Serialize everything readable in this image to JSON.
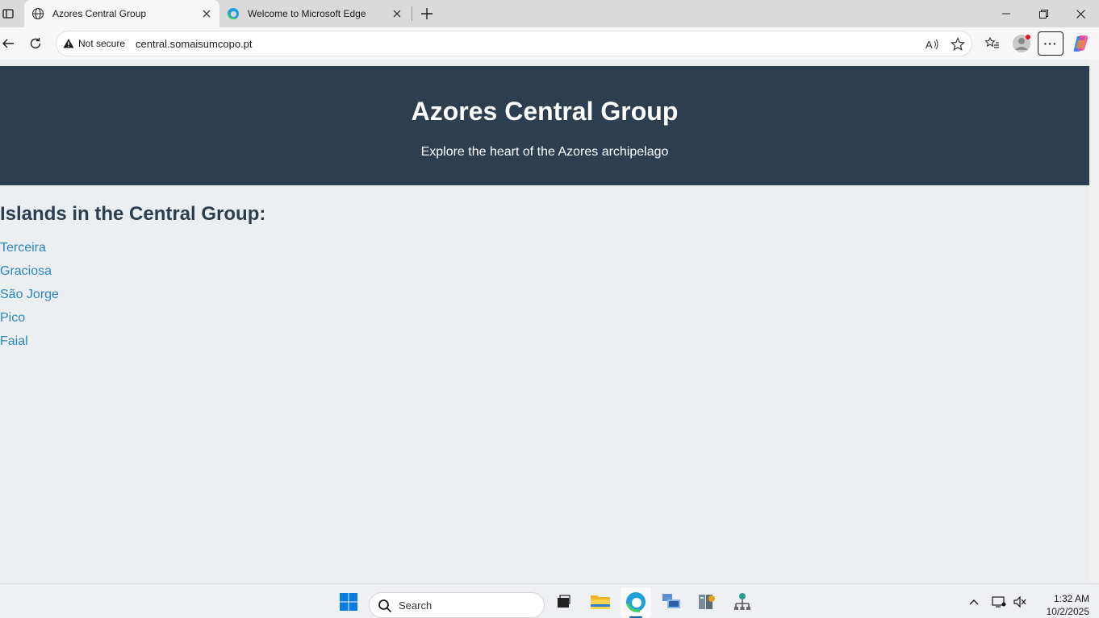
{
  "browser": {
    "tabs": [
      {
        "title": "Azores Central Group",
        "active": true
      },
      {
        "title": "Welcome to Microsoft Edge",
        "active": false
      }
    ],
    "address": {
      "security_label": "Not secure",
      "url": "central.somaisumcopo.pt"
    }
  },
  "page": {
    "hero": {
      "title": "Azores Central Group",
      "subtitle": "Explore the heart of the Azores archipelago"
    },
    "section_heading": "Islands in the Central Group:",
    "islands": [
      "Terceira",
      "Graciosa",
      "São Jorge",
      "Pico",
      "Faial"
    ]
  },
  "taskbar": {
    "search_label": "Search",
    "time": "1:32 AM",
    "date": "10/2/2025"
  },
  "colors": {
    "hero_bg": "#2c3e50",
    "link": "#2e86c1",
    "page_bg": "#eceff1"
  }
}
